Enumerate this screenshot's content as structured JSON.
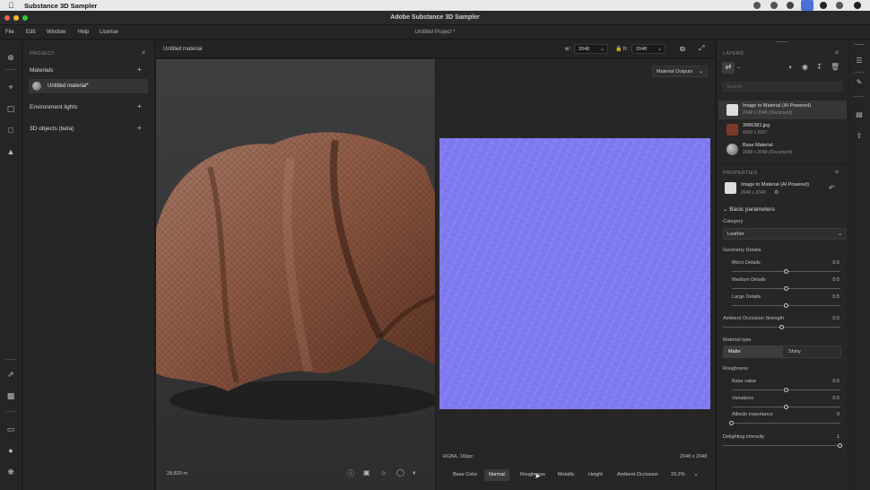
{
  "mac_menu": {
    "app_name": "Substance 3D Sampler"
  },
  "window": {
    "title": "Adobe Substance 3D Sampler"
  },
  "menu": {
    "items": [
      "File",
      "Edit",
      "Window",
      "Help",
      "License"
    ],
    "project_title": "Untitled Project *"
  },
  "project_panel": {
    "header": "PROJECT",
    "materials_label": "Materials",
    "material_item": "Untitled material*",
    "environment_label": "Environment lights",
    "objects_label": "3D objects (beta)"
  },
  "viewport": {
    "material_name": "Untitled material",
    "width_label": "w:",
    "width_value": "2048",
    "height_label": "h:",
    "height_value": "2048",
    "outputs_label": "Material Outputs",
    "scale_readout": "28,829 m",
    "format_readout": "RGBA, 16bpc",
    "resolution_readout": "2048 x 2048",
    "zoom_value": "29.2%",
    "channels": [
      "Base Color",
      "Normal",
      "Roughness",
      "Metallic",
      "Height",
      "Ambient Occlusion"
    ],
    "active_channel": "Normal"
  },
  "layers_panel": {
    "header": "LAYERS",
    "search_placeholder": "Search",
    "layers": [
      {
        "name": "Image to Material (AI Powered)",
        "sub": "2048 x 2048 (Document)"
      },
      {
        "name": "3986381.jpg",
        "sub": "4000 x 2667"
      },
      {
        "name": "Base Material",
        "sub": "2048 x 2048 (Document)"
      }
    ]
  },
  "properties_panel": {
    "header": "PROPERTIES",
    "node_name": "Image to Material (AI Powered)",
    "node_size": "2048 x 2048",
    "basic_params_label": "Basic parameters",
    "category_label": "Category",
    "category_value": "Leather",
    "geometry_label": "Geometry Details",
    "micro_label": "Micro Details",
    "micro_value": "0.5",
    "micro_level": 0.5,
    "medium_label": "Medium Details",
    "medium_value": "0.5",
    "medium_level": 0.5,
    "large_label": "Large Details",
    "large_value": "0.5",
    "large_level": 0.5,
    "ao_label": "Ambient Occlusion Strength",
    "ao_value": "0.5",
    "ao_level": 0.5,
    "material_type_label": "Material type",
    "matte_label": "Matte",
    "shiny_label": "Shiny",
    "roughness_label": "Roughness",
    "base_value_label": "Base value",
    "base_value": "0.5",
    "base_level": 0.5,
    "variations_label": "Variations",
    "variations_value": "0.5",
    "variations_level": 0.5,
    "albedo_label": "Albedo importance",
    "albedo_value": "0",
    "albedo_level": 0,
    "delighting_label": "Delighting intensity",
    "delighting_value": "1",
    "delighting_level": 1
  }
}
